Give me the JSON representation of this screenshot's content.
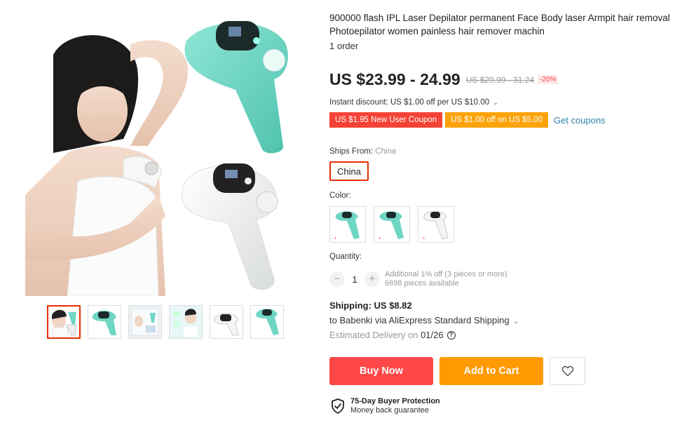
{
  "product": {
    "title": "900000 flash IPL Laser Depilator permanent Face Body laser Armpit hair removal Photoepilator women painless hair remover machin",
    "orders": "1 order",
    "price": "US $23.99 - 24.99",
    "original_price": "US $29.99 - 31.24",
    "discount": "-20%",
    "instant_discount": "Instant discount: US $1.00 off per US $10.00",
    "instant_chevron": "⌄"
  },
  "coupons": {
    "coupon1": "US $1.95 New User Coupon",
    "coupon2": "US $1.00 off on US $5.00",
    "get_coupons": "Get coupons"
  },
  "ships_from": {
    "label": "Ships From:",
    "value": "China",
    "option": "China"
  },
  "color": {
    "label": "Color:",
    "options": [
      "green",
      "green",
      "white"
    ]
  },
  "quantity": {
    "label": "Quantity:",
    "minus": "−",
    "value": "1",
    "plus": "+",
    "info1": "Additional 1% off (3 pieces or more)",
    "info2": "6698 pieces available"
  },
  "shipping": {
    "title": "Shipping: US $8.82",
    "to": "to Babenki via AliExpress Standard Shipping",
    "chevron": "⌄",
    "delivery_label": "Estimated Delivery on ",
    "delivery_date": "01/26",
    "help": "?"
  },
  "actions": {
    "buy_now": "Buy Now",
    "add_to_cart": "Add to Cart"
  },
  "protection": {
    "title": "75-Day Buyer Protection",
    "subtitle": "Money back guarantee"
  },
  "colors": {
    "accent_red": "#ff4747",
    "accent_orange": "#ff9a00",
    "device_green": "#6fd6c4",
    "device_white": "#f4f4f4",
    "link_blue": "#3182ac"
  }
}
